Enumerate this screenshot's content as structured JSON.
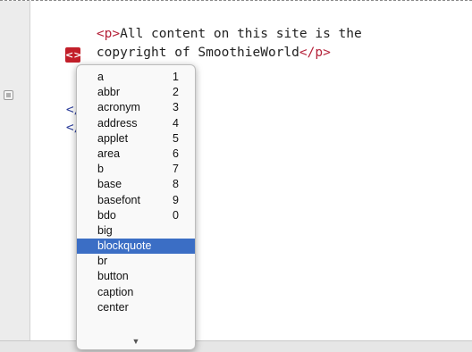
{
  "editor": {
    "lines": [
      {
        "pre": "",
        "open_tag": "<p>",
        "text": "All content on this site is the",
        "close_tag": ""
      },
      {
        "pre": "",
        "open_tag": "",
        "text": "copyright of SmoothieWorld",
        "close_tag": "</p>"
      },
      {
        "pre": "",
        "open_tag": "",
        "text": "",
        "close_tag": ""
      },
      {
        "pre": "",
        "open_tag": "</bod",
        "text": "",
        "close_tag": ""
      },
      {
        "pre": "",
        "open_tag": "</htm",
        "text": "",
        "close_tag": ""
      }
    ],
    "hint_marker": "<>"
  },
  "autocomplete": {
    "items": [
      {
        "label": "a",
        "shortcut": "1"
      },
      {
        "label": "abbr",
        "shortcut": "2"
      },
      {
        "label": "acronym",
        "shortcut": "3"
      },
      {
        "label": "address",
        "shortcut": "4"
      },
      {
        "label": "applet",
        "shortcut": "5"
      },
      {
        "label": "area",
        "shortcut": "6"
      },
      {
        "label": "b",
        "shortcut": "7"
      },
      {
        "label": "base",
        "shortcut": "8"
      },
      {
        "label": "basefont",
        "shortcut": "9"
      },
      {
        "label": "bdo",
        "shortcut": "0"
      },
      {
        "label": "big",
        "shortcut": ""
      },
      {
        "label": "blockquote",
        "shortcut": ""
      },
      {
        "label": "br",
        "shortcut": ""
      },
      {
        "label": "button",
        "shortcut": ""
      },
      {
        "label": "caption",
        "shortcut": ""
      },
      {
        "label": "center",
        "shortcut": ""
      }
    ],
    "selected_index": 11,
    "more_indicator": "▼"
  },
  "colors": {
    "tag_red": "#b5223a",
    "tag_blue": "#2a3c9a",
    "selection": "#3b6ec5"
  }
}
